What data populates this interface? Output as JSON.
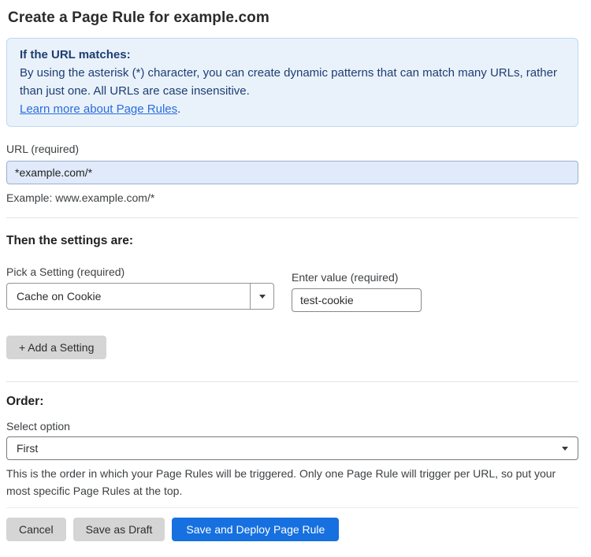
{
  "page": {
    "title": "Create a Page Rule for example.com"
  },
  "info_box": {
    "heading": "If the URL matches:",
    "body": "By using the asterisk (*) character, you can create dynamic patterns that can match many URLs, rather than just one. All URLs are case insensitive.",
    "link_label": "Learn more about Page Rules",
    "link_suffix": "."
  },
  "url_field": {
    "label": "URL (required)",
    "value": "*example.com/*",
    "helper": "Example: www.example.com/*"
  },
  "settings_section": {
    "heading": "Then the settings are:",
    "setting_picker": {
      "label": "Pick a Setting (required)",
      "selected_value": "Cache on Cookie"
    },
    "value_field": {
      "label": "Enter value (required)",
      "value": "test-cookie"
    },
    "add_setting_label": "+ Add a Setting"
  },
  "order_section": {
    "heading": "Order:",
    "select_label": "Select option",
    "selected_value": "First",
    "helper": "This is the order in which your Page Rules will be triggered. Only one Page Rule will trigger per URL, so put your most specific Page Rules at the top."
  },
  "footer": {
    "cancel_label": "Cancel",
    "save_draft_label": "Save as Draft",
    "save_deploy_label": "Save and Deploy Page Rule"
  },
  "colors": {
    "info_background": "#e9f2fb",
    "info_border": "#bfd9f2",
    "info_text": "#1f3d71",
    "link_blue": "#2b6cd9",
    "url_input_background": "#e0eafa",
    "primary_button_blue": "#1670e0",
    "secondary_button_gray": "#d5d5d5"
  }
}
